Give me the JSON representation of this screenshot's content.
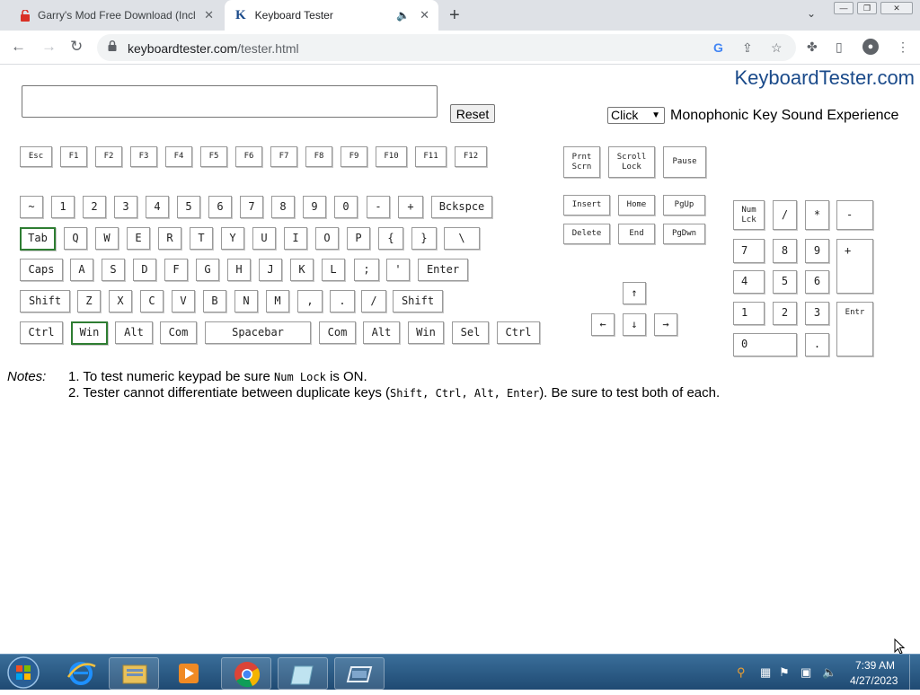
{
  "browser": {
    "tabs": [
      {
        "title": "Garry's Mod Free Download (Incl"
      },
      {
        "title": "Keyboard Tester"
      }
    ],
    "url_domain": "keyboardtester.com",
    "url_path": "/tester.html"
  },
  "page": {
    "logo": "KeyboardTester.com",
    "reset_label": "Reset",
    "sound_select_value": "Click",
    "sound_label": "Monophonic Key Sound Experience",
    "notes_label": "Notes:",
    "note1_prefix": "1. To test numeric keypad be sure ",
    "note1_code": "Num Lock",
    "note1_suffix": " is ON.",
    "note2_prefix": "2. Tester cannot differentiate between duplicate keys (",
    "note2_code": "Shift, Ctrl, Alt, Enter",
    "note2_suffix": "). Be sure to test both of each."
  },
  "keys": {
    "esc": "Esc",
    "f1": "F1",
    "f2": "F2",
    "f3": "F3",
    "f4": "F4",
    "f5": "F5",
    "f6": "F6",
    "f7": "F7",
    "f8": "F8",
    "f9": "F9",
    "f10": "F10",
    "f11": "F11",
    "f12": "F12",
    "prntscrn": "Prnt\nScrn",
    "scrolllock": "Scroll\nLock",
    "pause": "Pause",
    "tilde": "~",
    "n1": "1",
    "n2": "2",
    "n3": "3",
    "n4": "4",
    "n5": "5",
    "n6": "6",
    "n7": "7",
    "n8": "8",
    "n9": "9",
    "n0": "0",
    "minus": "-",
    "plus": "+",
    "backspace": "Bckspce",
    "tab": "Tab",
    "q": "Q",
    "w": "W",
    "e": "E",
    "r": "R",
    "t": "T",
    "y": "Y",
    "u": "U",
    "i": "I",
    "o": "O",
    "p": "P",
    "lbrace": "{",
    "rbrace": "}",
    "backslash": "\\",
    "caps": "Caps",
    "a": "A",
    "s": "S",
    "d": "D",
    "f": "F",
    "g": "G",
    "h": "H",
    "j": "J",
    "k": "K",
    "l": "L",
    "semicolon": ";",
    "quote": "'",
    "enter": "Enter",
    "lshift": "Shift",
    "z": "Z",
    "x": "X",
    "c": "C",
    "v": "V",
    "b": "B",
    "n": "N",
    "m": "M",
    "comma": ",",
    "period": ".",
    "slash": "/",
    "rshift": "Shift",
    "lctrl": "Ctrl",
    "lwin": "Win",
    "lalt": "Alt",
    "lcom": "Com",
    "space": "Spacebar",
    "rcom": "Com",
    "ralt": "Alt",
    "rwin": "Win",
    "sel": "Sel",
    "rctrl": "Ctrl",
    "insert": "Insert",
    "home": "Home",
    "pgup": "PgUp",
    "delete": "Delete",
    "end": "End",
    "pgdwn": "PgDwn",
    "up": "↑",
    "left": "←",
    "down": "↓",
    "right": "→",
    "numlock": "Num\nLck",
    "kp_slash": "/",
    "kp_star": "*",
    "kp_minus": "-",
    "kp7": "7",
    "kp8": "8",
    "kp9": "9",
    "kp_plus": "+",
    "kp4": "4",
    "kp5": "5",
    "kp6": "6",
    "kp1": "1",
    "kp2": "2",
    "kp3": "3",
    "kp_enter": "Entr",
    "kp0": "0",
    "kp_dot": "."
  },
  "taskbar": {
    "time": "7:39 AM",
    "date": "4/27/2023"
  },
  "colors": {
    "active_key_border": "#2e7d32",
    "logo": "#1a4a8a"
  }
}
